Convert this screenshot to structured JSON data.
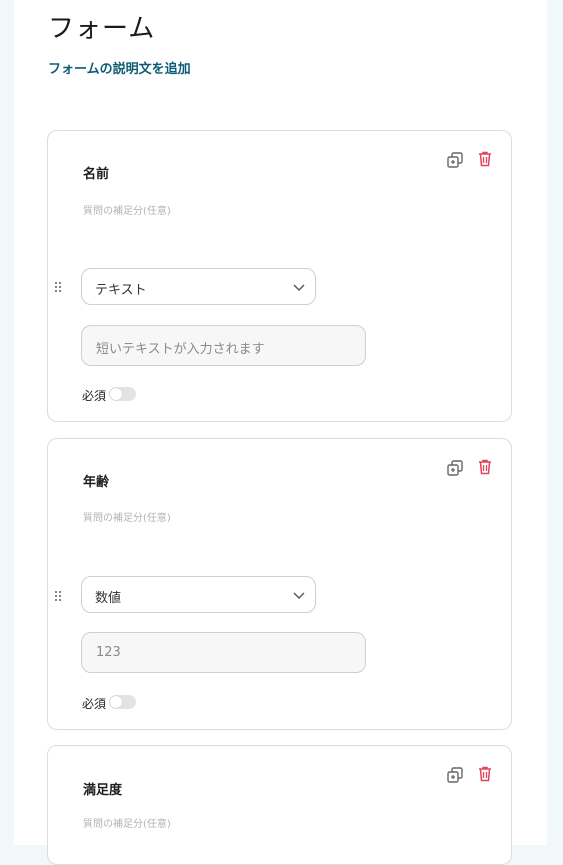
{
  "form": {
    "title": "フォーム",
    "description_link": "フォームの説明文を追加"
  },
  "questions": [
    {
      "title": "名前",
      "subtitle": "質問の補足分(任意)",
      "type": "テキスト",
      "placeholder": "短いテキストが入力されます",
      "required_label": "必須",
      "required": false
    },
    {
      "title": "年齢",
      "subtitle": "質問の補足分(任意)",
      "type": "数値",
      "placeholder": "123",
      "required_label": "必須",
      "required": false
    },
    {
      "title": "満足度",
      "subtitle": "質問の補足分(任意)"
    }
  ],
  "colors": {
    "accent_link": "#0d5c73",
    "delete_icon": "#e2445c",
    "background": "#f1f8f8"
  },
  "icons": {
    "copy": "duplicate-icon",
    "delete": "trash-icon",
    "drag": "drag-handle-icon",
    "dropdown": "chevron-down-icon"
  }
}
